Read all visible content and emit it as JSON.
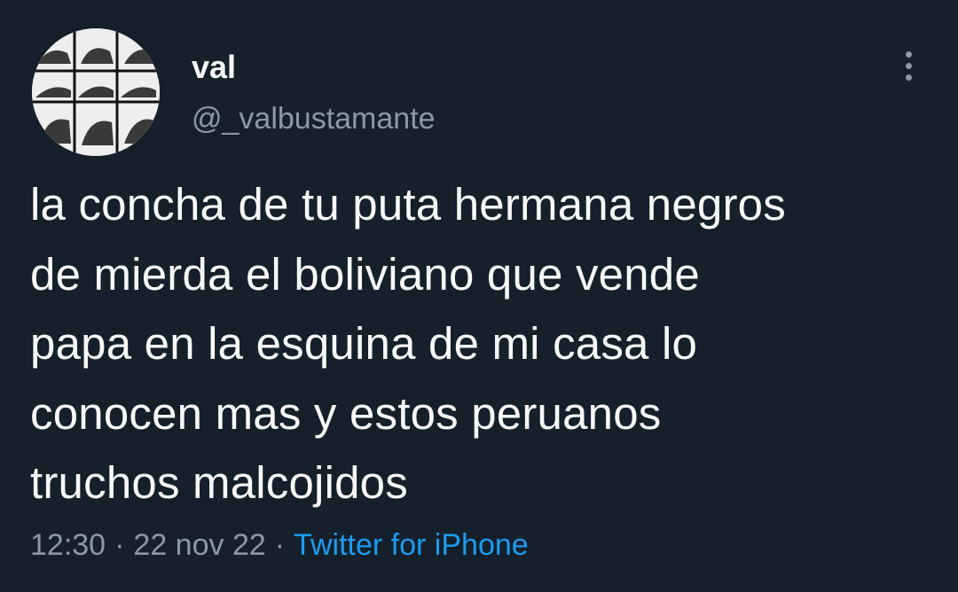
{
  "tweet": {
    "user": {
      "display_name": "val",
      "handle": "@_valbustamante"
    },
    "text": "la concha de tu puta hermana negros\nde mierda el boliviano que vende\npapa en la esquina de mi casa lo\nconocen mas y estos peruanos\ntruchos malcojidos",
    "time": "12:30",
    "separator": "·",
    "date": "22 nov 22",
    "source": "Twitter for iPhone"
  },
  "icons": {
    "more": "more-vertical-icon"
  },
  "colors": {
    "background": "#15202b",
    "primary_text": "#f7f9f9",
    "secondary_text": "#8b98a5",
    "link": "#1d9bf0"
  }
}
